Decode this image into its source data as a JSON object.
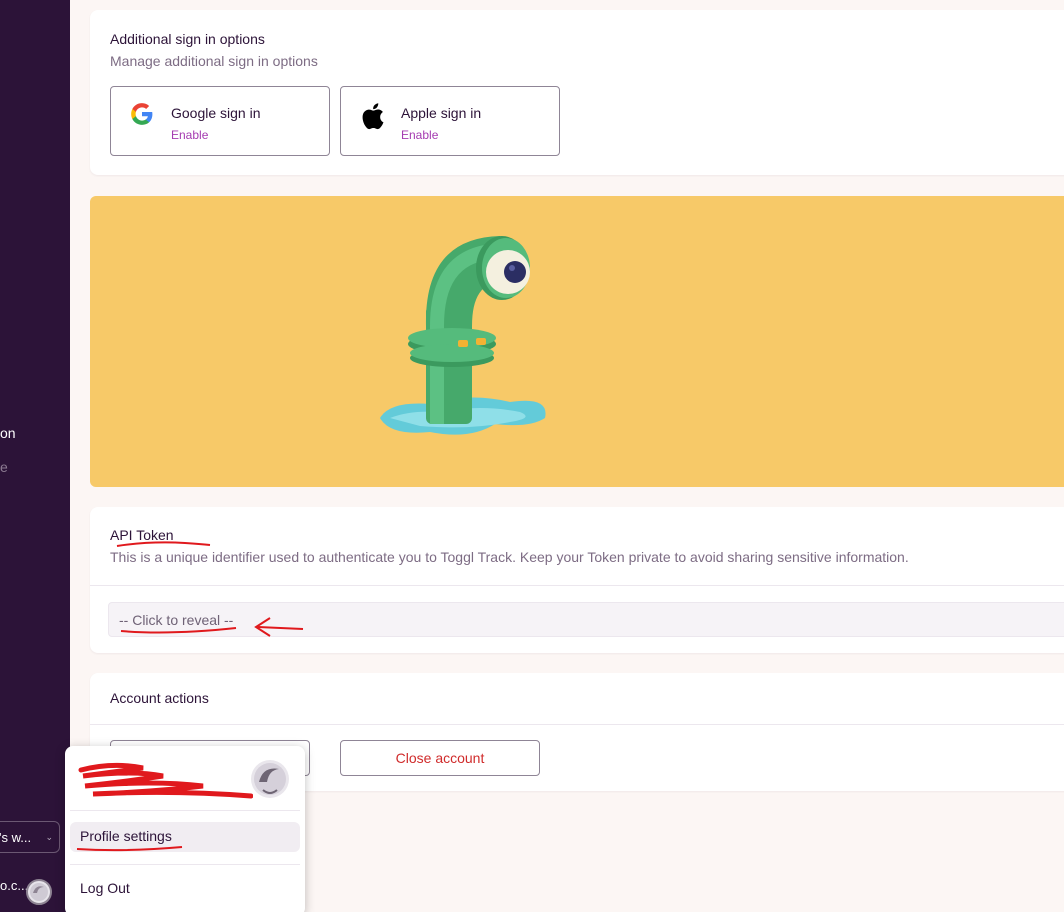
{
  "sidebar": {
    "partial_text_1": "on",
    "partial_text_2": "e",
    "workspace_label": "'s w...",
    "user_label": "o.c..."
  },
  "signin": {
    "title": "Additional sign in options",
    "subtitle": "Manage additional sign in options",
    "providers": [
      {
        "label": "Google sign in",
        "action": "Enable",
        "icon": "google-icon"
      },
      {
        "label": "Apple sign in",
        "action": "Enable",
        "icon": "apple-icon"
      }
    ]
  },
  "api_token": {
    "title": "API Token",
    "description": "This is a unique identifier used to authenticate you to Toggl Track. Keep your Token private to avoid sharing sensitive information.",
    "reveal_label": "-- Click to reveal --"
  },
  "account_actions": {
    "title": "Account actions",
    "close_label": "Close account"
  },
  "user_menu": {
    "profile_settings": "Profile settings",
    "logout": "Log Out"
  },
  "colors": {
    "sidebar_bg": "#2c1338",
    "accent": "#a53bb1",
    "danger": "#d02b2b",
    "banner_bg": "#f7c968",
    "annotation": "#e0191d"
  }
}
